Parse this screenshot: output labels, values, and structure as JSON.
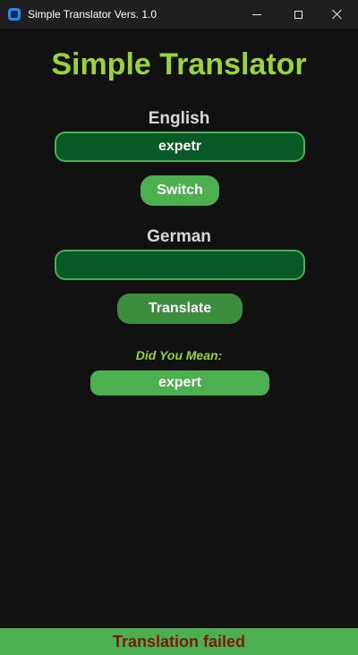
{
  "window": {
    "title": "Simple Translator Vers. 1.0",
    "icon": "app-icon"
  },
  "main": {
    "heading": "Simple Translator",
    "source": {
      "language": "English",
      "text": "expetr"
    },
    "switch_label": "Switch",
    "target": {
      "language": "German",
      "text": ""
    },
    "translate_label": "Translate",
    "suggestion": {
      "label": "Did You Mean:",
      "value": "expert"
    }
  },
  "status": {
    "text": "Translation failed"
  },
  "colors": {
    "background": "#111112",
    "accent_green": "#4caf50",
    "heading_green": "#9bd23b",
    "field_bg": "#075a25",
    "status_text": "#7a1a10"
  }
}
